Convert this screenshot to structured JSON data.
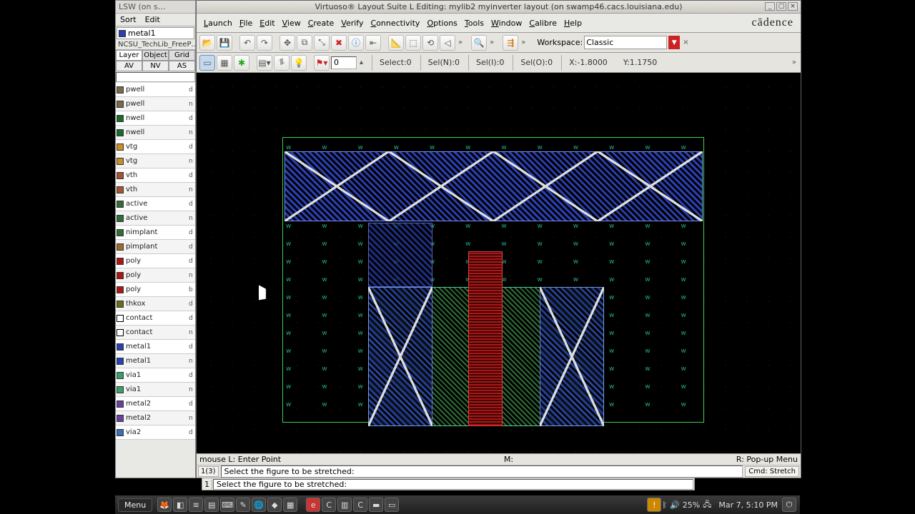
{
  "lsw": {
    "title": "LSW (on s…",
    "menu": {
      "sort": "Sort",
      "edit": "Edit"
    },
    "current_layer": "metal1",
    "lib": "NCSU_TechLib_FreeP…",
    "tabs": {
      "layer": "Layer",
      "object": "Object",
      "grid": "Grid"
    },
    "filter": {
      "av": "AV",
      "nv": "NV",
      "as": "AS"
    },
    "layers": [
      {
        "n": "pwell",
        "c": "c-pwell",
        "p": "d"
      },
      {
        "n": "pwell",
        "c": "c-pwell",
        "p": "n"
      },
      {
        "n": "nwell",
        "c": "c-nwell",
        "p": "d"
      },
      {
        "n": "nwell",
        "c": "c-nwell",
        "p": "n"
      },
      {
        "n": "vtg",
        "c": "c-vtg",
        "p": "d"
      },
      {
        "n": "vtg",
        "c": "c-vtg",
        "p": "n"
      },
      {
        "n": "vth",
        "c": "c-vth",
        "p": "d"
      },
      {
        "n": "vth",
        "c": "c-vth",
        "p": "n"
      },
      {
        "n": "active",
        "c": "c-active",
        "p": "d"
      },
      {
        "n": "active",
        "c": "c-active",
        "p": "n"
      },
      {
        "n": "nimplant",
        "c": "c-nimp",
        "p": "d"
      },
      {
        "n": "pimplant",
        "c": "c-pimp",
        "p": "d"
      },
      {
        "n": "poly",
        "c": "c-poly",
        "p": "d"
      },
      {
        "n": "poly",
        "c": "c-poly",
        "p": "n"
      },
      {
        "n": "poly",
        "c": "c-poly",
        "p": "b"
      },
      {
        "n": "thkox",
        "c": "c-thkox",
        "p": "d"
      },
      {
        "n": "contact",
        "c": "c-contact",
        "p": "d"
      },
      {
        "n": "contact",
        "c": "c-contact",
        "p": "n"
      },
      {
        "n": "metal1",
        "c": "c-metal1",
        "p": "d"
      },
      {
        "n": "metal1",
        "c": "c-metal1",
        "p": "n"
      },
      {
        "n": "via1",
        "c": "c-via1",
        "p": "d"
      },
      {
        "n": "via1",
        "c": "c-via1",
        "p": "n"
      },
      {
        "n": "metal2",
        "c": "c-metal2",
        "p": "d"
      },
      {
        "n": "metal2",
        "c": "c-metal2",
        "p": "n"
      },
      {
        "n": "via2",
        "c": "c-via2",
        "p": "d"
      }
    ]
  },
  "editor": {
    "title": "Virtuoso® Layout Suite L Editing: mylib2 myinverter layout (on swamp46.cacs.louisiana.edu)",
    "menu": [
      "Launch",
      "File",
      "Edit",
      "View",
      "Create",
      "Verify",
      "Connectivity",
      "Options",
      "Tools",
      "Window",
      "Calibre",
      "Help"
    ],
    "brand": "cādence",
    "workspace_label": "Workspace:",
    "workspace_value": "Classic",
    "spin_value": "0",
    "status": {
      "select": "Select:0",
      "seln": "Sel(N):0",
      "seli": "Sel(I):0",
      "selo": "Sel(O):0",
      "x": "X:-1.8000",
      "y": "Y:1.1750"
    },
    "mouse": {
      "l": "mouse L: Enter Point",
      "m": "M:",
      "r": "R: Pop-up Menu"
    },
    "prompt_idx": "1(3)",
    "prompt_txt": "Select the figure to be stretched:",
    "cmd": "Cmd: Stretch"
  },
  "ciw": {
    "idx": "1",
    "msg": "Select the figure to be stretched:"
  },
  "taskbar": {
    "menu": "Menu",
    "clock": "Mar 7, 5:10 PM",
    "battery": "25%"
  }
}
